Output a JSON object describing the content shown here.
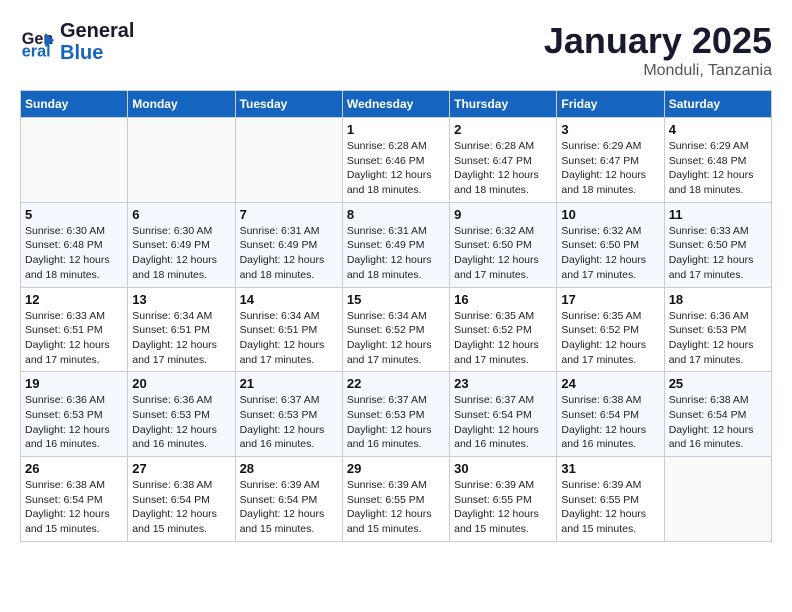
{
  "header": {
    "logo_line1": "General",
    "logo_line2": "Blue",
    "month": "January 2025",
    "location": "Monduli, Tanzania"
  },
  "weekdays": [
    "Sunday",
    "Monday",
    "Tuesday",
    "Wednesday",
    "Thursday",
    "Friday",
    "Saturday"
  ],
  "weeks": [
    [
      {
        "day": "",
        "sunrise": "",
        "sunset": "",
        "daylight": ""
      },
      {
        "day": "",
        "sunrise": "",
        "sunset": "",
        "daylight": ""
      },
      {
        "day": "",
        "sunrise": "",
        "sunset": "",
        "daylight": ""
      },
      {
        "day": "1",
        "sunrise": "Sunrise: 6:28 AM",
        "sunset": "Sunset: 6:46 PM",
        "daylight": "Daylight: 12 hours and 18 minutes."
      },
      {
        "day": "2",
        "sunrise": "Sunrise: 6:28 AM",
        "sunset": "Sunset: 6:47 PM",
        "daylight": "Daylight: 12 hours and 18 minutes."
      },
      {
        "day": "3",
        "sunrise": "Sunrise: 6:29 AM",
        "sunset": "Sunset: 6:47 PM",
        "daylight": "Daylight: 12 hours and 18 minutes."
      },
      {
        "day": "4",
        "sunrise": "Sunrise: 6:29 AM",
        "sunset": "Sunset: 6:48 PM",
        "daylight": "Daylight: 12 hours and 18 minutes."
      }
    ],
    [
      {
        "day": "5",
        "sunrise": "Sunrise: 6:30 AM",
        "sunset": "Sunset: 6:48 PM",
        "daylight": "Daylight: 12 hours and 18 minutes."
      },
      {
        "day": "6",
        "sunrise": "Sunrise: 6:30 AM",
        "sunset": "Sunset: 6:49 PM",
        "daylight": "Daylight: 12 hours and 18 minutes."
      },
      {
        "day": "7",
        "sunrise": "Sunrise: 6:31 AM",
        "sunset": "Sunset: 6:49 PM",
        "daylight": "Daylight: 12 hours and 18 minutes."
      },
      {
        "day": "8",
        "sunrise": "Sunrise: 6:31 AM",
        "sunset": "Sunset: 6:49 PM",
        "daylight": "Daylight: 12 hours and 18 minutes."
      },
      {
        "day": "9",
        "sunrise": "Sunrise: 6:32 AM",
        "sunset": "Sunset: 6:50 PM",
        "daylight": "Daylight: 12 hours and 17 minutes."
      },
      {
        "day": "10",
        "sunrise": "Sunrise: 6:32 AM",
        "sunset": "Sunset: 6:50 PM",
        "daylight": "Daylight: 12 hours and 17 minutes."
      },
      {
        "day": "11",
        "sunrise": "Sunrise: 6:33 AM",
        "sunset": "Sunset: 6:50 PM",
        "daylight": "Daylight: 12 hours and 17 minutes."
      }
    ],
    [
      {
        "day": "12",
        "sunrise": "Sunrise: 6:33 AM",
        "sunset": "Sunset: 6:51 PM",
        "daylight": "Daylight: 12 hours and 17 minutes."
      },
      {
        "day": "13",
        "sunrise": "Sunrise: 6:34 AM",
        "sunset": "Sunset: 6:51 PM",
        "daylight": "Daylight: 12 hours and 17 minutes."
      },
      {
        "day": "14",
        "sunrise": "Sunrise: 6:34 AM",
        "sunset": "Sunset: 6:51 PM",
        "daylight": "Daylight: 12 hours and 17 minutes."
      },
      {
        "day": "15",
        "sunrise": "Sunrise: 6:34 AM",
        "sunset": "Sunset: 6:52 PM",
        "daylight": "Daylight: 12 hours and 17 minutes."
      },
      {
        "day": "16",
        "sunrise": "Sunrise: 6:35 AM",
        "sunset": "Sunset: 6:52 PM",
        "daylight": "Daylight: 12 hours and 17 minutes."
      },
      {
        "day": "17",
        "sunrise": "Sunrise: 6:35 AM",
        "sunset": "Sunset: 6:52 PM",
        "daylight": "Daylight: 12 hours and 17 minutes."
      },
      {
        "day": "18",
        "sunrise": "Sunrise: 6:36 AM",
        "sunset": "Sunset: 6:53 PM",
        "daylight": "Daylight: 12 hours and 17 minutes."
      }
    ],
    [
      {
        "day": "19",
        "sunrise": "Sunrise: 6:36 AM",
        "sunset": "Sunset: 6:53 PM",
        "daylight": "Daylight: 12 hours and 16 minutes."
      },
      {
        "day": "20",
        "sunrise": "Sunrise: 6:36 AM",
        "sunset": "Sunset: 6:53 PM",
        "daylight": "Daylight: 12 hours and 16 minutes."
      },
      {
        "day": "21",
        "sunrise": "Sunrise: 6:37 AM",
        "sunset": "Sunset: 6:53 PM",
        "daylight": "Daylight: 12 hours and 16 minutes."
      },
      {
        "day": "22",
        "sunrise": "Sunrise: 6:37 AM",
        "sunset": "Sunset: 6:53 PM",
        "daylight": "Daylight: 12 hours and 16 minutes."
      },
      {
        "day": "23",
        "sunrise": "Sunrise: 6:37 AM",
        "sunset": "Sunset: 6:54 PM",
        "daylight": "Daylight: 12 hours and 16 minutes."
      },
      {
        "day": "24",
        "sunrise": "Sunrise: 6:38 AM",
        "sunset": "Sunset: 6:54 PM",
        "daylight": "Daylight: 12 hours and 16 minutes."
      },
      {
        "day": "25",
        "sunrise": "Sunrise: 6:38 AM",
        "sunset": "Sunset: 6:54 PM",
        "daylight": "Daylight: 12 hours and 16 minutes."
      }
    ],
    [
      {
        "day": "26",
        "sunrise": "Sunrise: 6:38 AM",
        "sunset": "Sunset: 6:54 PM",
        "daylight": "Daylight: 12 hours and 15 minutes."
      },
      {
        "day": "27",
        "sunrise": "Sunrise: 6:38 AM",
        "sunset": "Sunset: 6:54 PM",
        "daylight": "Daylight: 12 hours and 15 minutes."
      },
      {
        "day": "28",
        "sunrise": "Sunrise: 6:39 AM",
        "sunset": "Sunset: 6:54 PM",
        "daylight": "Daylight: 12 hours and 15 minutes."
      },
      {
        "day": "29",
        "sunrise": "Sunrise: 6:39 AM",
        "sunset": "Sunset: 6:55 PM",
        "daylight": "Daylight: 12 hours and 15 minutes."
      },
      {
        "day": "30",
        "sunrise": "Sunrise: 6:39 AM",
        "sunset": "Sunset: 6:55 PM",
        "daylight": "Daylight: 12 hours and 15 minutes."
      },
      {
        "day": "31",
        "sunrise": "Sunrise: 6:39 AM",
        "sunset": "Sunset: 6:55 PM",
        "daylight": "Daylight: 12 hours and 15 minutes."
      },
      {
        "day": "",
        "sunrise": "",
        "sunset": "",
        "daylight": ""
      }
    ]
  ]
}
